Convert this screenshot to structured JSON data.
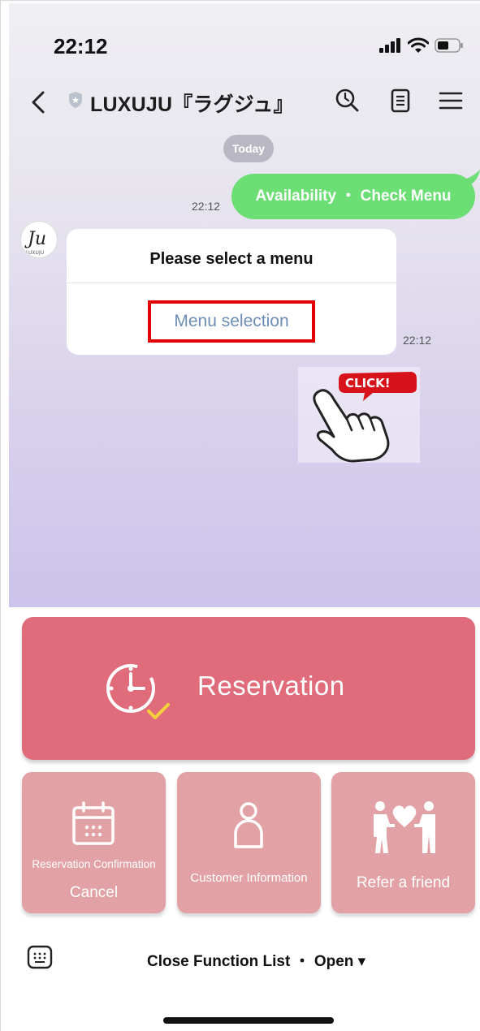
{
  "status_bar": {
    "time": "22:12"
  },
  "header": {
    "title": "LUXUJU『ラグジュ』"
  },
  "chat": {
    "date_separator": "Today",
    "outgoing": {
      "text": "Availability ・ Check Menu",
      "time": "22:12"
    },
    "incoming_card": {
      "title": "Please select a menu",
      "action_label": "Menu selection",
      "time": "22:12"
    },
    "avatar_text": "Ju",
    "avatar_sub": "LUXUJU",
    "click_badge": "CLICK!"
  },
  "rich_menu": {
    "main_button": "Reservation",
    "buttons": [
      {
        "line1": "Reservation Confirmation",
        "line2": "Cancel"
      },
      {
        "line1": "Customer Information"
      },
      {
        "line1": "Refer a friend"
      }
    ]
  },
  "bottom_bar": {
    "label": "Close Function List ・ Open ▾"
  },
  "colors": {
    "accent_green": "#6bde74",
    "reservation_pink": "#df6b7b",
    "button_pink": "#e2a2a5",
    "highlight_red": "#e40000",
    "link_blue": "#6d8db5"
  }
}
